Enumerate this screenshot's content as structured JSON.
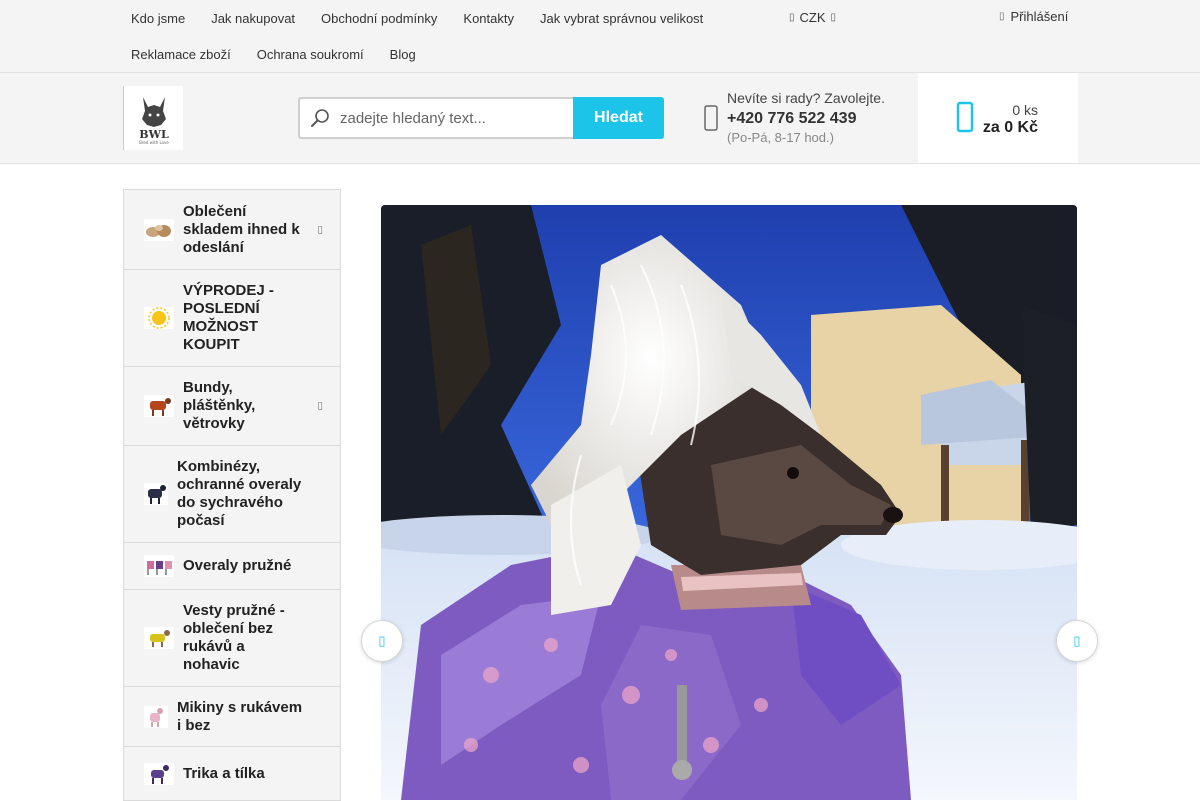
{
  "topnav": {
    "row1": [
      "Kdo jsme",
      "Jak nakupovat",
      "Obchodní podmínky",
      "Kontakty",
      "Jak vybrat správnou velikost"
    ],
    "row2": [
      "Reklamace zboží",
      "Ochrana soukromí",
      "Blog"
    ]
  },
  "currency": {
    "value": "CZK",
    "icon": "chevron-down-icon"
  },
  "login": {
    "label": "Přihlášení",
    "icon": "user-icon"
  },
  "logo": {
    "text": "BWL",
    "sub": "Bred with Love"
  },
  "search": {
    "placeholder": "zadejte hledaný text...",
    "button": "Hledat",
    "icon": "search-icon"
  },
  "help": {
    "question": "Nevíte si rady? Zavolejte.",
    "phone": "+420 776 522 439",
    "hours": "(Po-Pá, 8-17 hod.)",
    "icon": "phone-icon"
  },
  "cart": {
    "count": "0 ks",
    "price": "za 0 Kč",
    "icon": "cart-icon"
  },
  "sidebar": {
    "items": [
      {
        "label": "Oblečení skladem ihned k odeslání",
        "has_children": true
      },
      {
        "label": "VÝPRODEJ - POSLEDNÍ MOŽNOST KOUPIT",
        "has_children": false
      },
      {
        "label": "Bundy, pláštěnky, větrovky",
        "has_children": true
      },
      {
        "label": "Kombinézy, ochranné overaly do sychravého počasí",
        "has_children": false
      },
      {
        "label": "Overaly pružné",
        "has_children": false
      },
      {
        "label": "Vesty pružné - oblečení bez rukávů a nohavic",
        "has_children": false
      },
      {
        "label": "Mikiny s rukávem i bez",
        "has_children": false
      },
      {
        "label": "Trika a tílka",
        "has_children": false
      }
    ]
  },
  "slider": {
    "prev_icon": "chevron-left-icon",
    "next_icon": "chevron-right-icon"
  },
  "colors": {
    "accent": "#1cc4ea",
    "background": "#f4f4f4"
  }
}
